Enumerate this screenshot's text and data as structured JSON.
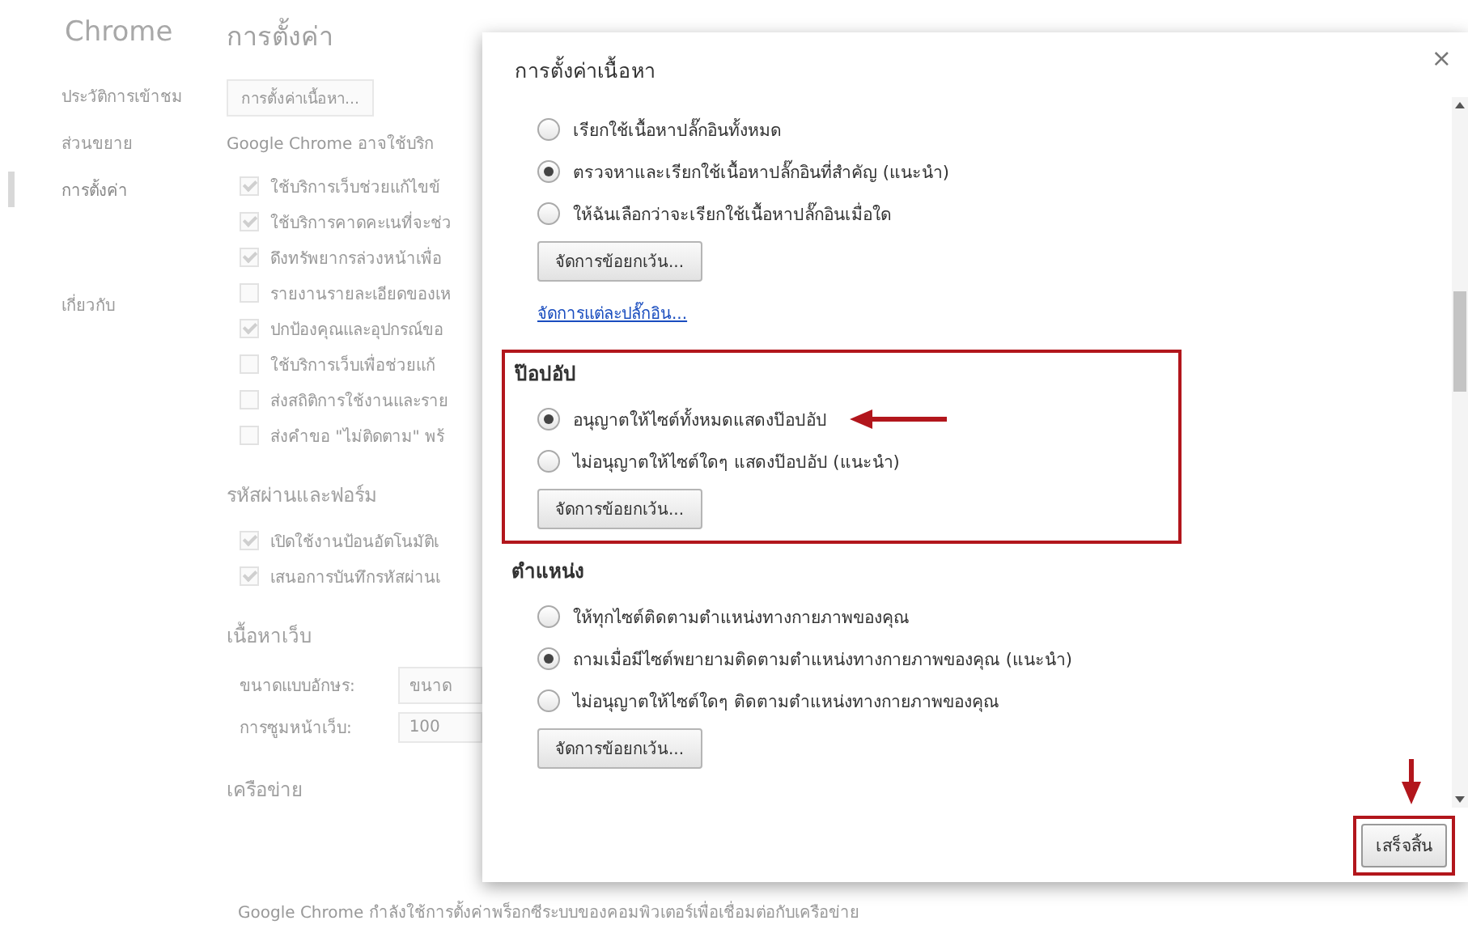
{
  "sidebar": {
    "title": "Chrome",
    "items": [
      {
        "label": "ประวัติการเข้าชม",
        "selected": false
      },
      {
        "label": "ส่วนขยาย",
        "selected": false
      },
      {
        "label": "การตั้งค่า",
        "selected": true
      },
      {
        "label": "เกี่ยวกับ",
        "selected": false
      }
    ]
  },
  "settings": {
    "title": "การตั้งค่า",
    "buttons": [
      "การตั้งค่าเนื้อหา..."
    ],
    "note": "Google Chrome อาจใช้บริก",
    "privacy": [
      {
        "label": "ใช้บริการเว็บช่วยแก้ไขข้",
        "checked": true
      },
      {
        "label": "ใช้บริการคาดคะเนที่จะช่ว",
        "checked": true
      },
      {
        "label": "ดึงทรัพยากรล่วงหน้าเพื่อ",
        "checked": true
      },
      {
        "label": "รายงานรายละเอียดของเห",
        "checked": false
      },
      {
        "label": "ปกป้องคุณและอุปกรณ์ขอ",
        "checked": true
      },
      {
        "label": "ใช้บริการเว็บเพื่อช่วยแก้",
        "checked": false
      },
      {
        "label": "ส่งสถิติการใช้งานและราย",
        "checked": false
      },
      {
        "label": "ส่งคำขอ \"ไม่ติดตาม\" พร้",
        "checked": false
      }
    ],
    "passwords": {
      "title": "รหัสผ่านและฟอร์ม",
      "items": [
        {
          "label": "เปิดใช้งานป้อนอัตโนมัติเ",
          "checked": true
        },
        {
          "label": "เสนอการบันทึกรหัสผ่านเ",
          "checked": true
        }
      ]
    },
    "web_content": {
      "title": "เนื้อหาเว็บ",
      "fields": [
        {
          "label": "ขนาดแบบอักษร:",
          "value": "ขนาด"
        },
        {
          "label": "การซูมหน้าเว็บ:",
          "value": "100"
        }
      ]
    },
    "network": {
      "title": "เครือข่าย",
      "note": "Google Chrome กำลังใช้การตั้งค่าพร็อกซีระบบของคอมพิวเตอร์เพื่อเชื่อมต่อกับเครือข่าย"
    }
  },
  "dialog": {
    "title": "การตั้งค่าเนื้อหา",
    "close": "×",
    "sections": [
      {
        "options": [
          {
            "label": "เรียกใช้เนื้อหาปลั๊กอินทั้งหมด",
            "selected": false
          },
          {
            "label": "ตรวจหาและเรียกใช้เนื้อหาปลั๊กอินที่สำคัญ (แนะนำ)",
            "selected": true
          },
          {
            "label": "ให้ฉันเลือกว่าจะเรียกใช้เนื้อหาปลั๊กอินเมื่อใด",
            "selected": false
          }
        ],
        "button": "จัดการข้อยกเว้น...",
        "link": "จัดการแต่ละปลั๊กอิน..."
      },
      {
        "heading": "ป๊อปอัป",
        "options": [
          {
            "label": "อนุญาตให้ไซต์ทั้งหมดแสดงป๊อปอัป",
            "selected": true,
            "marked": true
          },
          {
            "label": "ไม่อนุญาตให้ไซต์ใดๆ แสดงป๊อปอัป (แนะนำ)",
            "selected": false
          }
        ],
        "button": "จัดการข้อยกเว้น...",
        "highlighted": true
      },
      {
        "heading": "ตำแหน่ง",
        "options": [
          {
            "label": "ให้ทุกไซต์ติดตามตำแหน่งทางกายภาพของคุณ",
            "selected": false
          },
          {
            "label": "ถามเมื่อมีไซต์พยายามติดตามตำแหน่งทางกายภาพของคุณ (แนะนำ)",
            "selected": true
          },
          {
            "label": "ไม่อนุญาตให้ไซต์ใดๆ ติดตามตำแหน่งทางกายภาพของคุณ",
            "selected": false
          }
        ],
        "button": "จัดการข้อยกเว้น..."
      }
    ],
    "done_button": {
      "label": "เสร็จสิ้น",
      "highlighted": true
    }
  }
}
